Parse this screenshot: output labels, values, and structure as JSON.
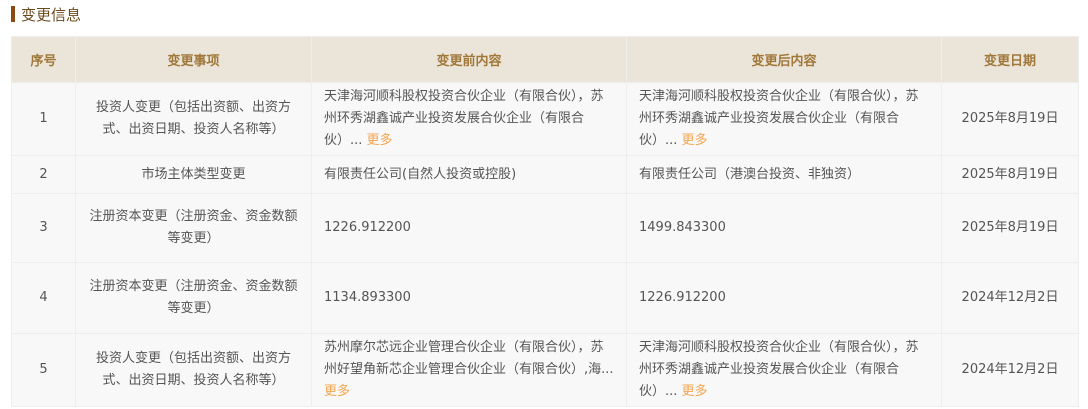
{
  "section_title": "变更信息",
  "headers": [
    "序号",
    "变更事项",
    "变更前内容",
    "变更后内容",
    "变更日期"
  ],
  "more_label": "更多",
  "rows": [
    {
      "no": "1",
      "item": "投资人变更（包括出资额、出资方式、出资日期、投资人名称等）",
      "before": "天津海河顺科股权投资合伙企业（有限合伙），苏州环秀湖鑫诚产业投资发展合伙企业（有限合伙）...",
      "after": "天津海河顺科股权投资合伙企业（有限合伙），苏州环秀湖鑫诚产业投资发展合伙企业（有限合伙）...",
      "date": "2025年8月19日",
      "before_more": true,
      "after_more": true
    },
    {
      "no": "2",
      "item": "市场主体类型变更",
      "before": "有限责任公司(自然人投资或控股)",
      "after": "有限责任公司（港澳台投资、非独资）",
      "date": "2025年8月19日"
    },
    {
      "no": "3",
      "item": "注册资本变更（注册资金、资金数额等变更）",
      "before": "1226.912200",
      "after": "1499.843300",
      "date": "2025年8月19日"
    },
    {
      "no": "4",
      "item": "注册资本变更（注册资金、资金数额等变更）",
      "before": "1134.893300",
      "after": "1226.912200",
      "date": "2024年12月2日"
    },
    {
      "no": "5",
      "item": "投资人变更（包括出资额、出资方式、出资日期、投资人名称等）",
      "before": "苏州摩尔芯远企业管理合伙企业（有限合伙），苏州好望角新芯企业管理合伙企业（有限合伙）,海...",
      "after": "天津海河顺科股权投资合伙企业（有限合伙），苏州环秀湖鑫诚产业投资发展合伙企业（有限合伙）...",
      "date": "2024年12月2日",
      "before_more": true,
      "after_more": true
    }
  ]
}
